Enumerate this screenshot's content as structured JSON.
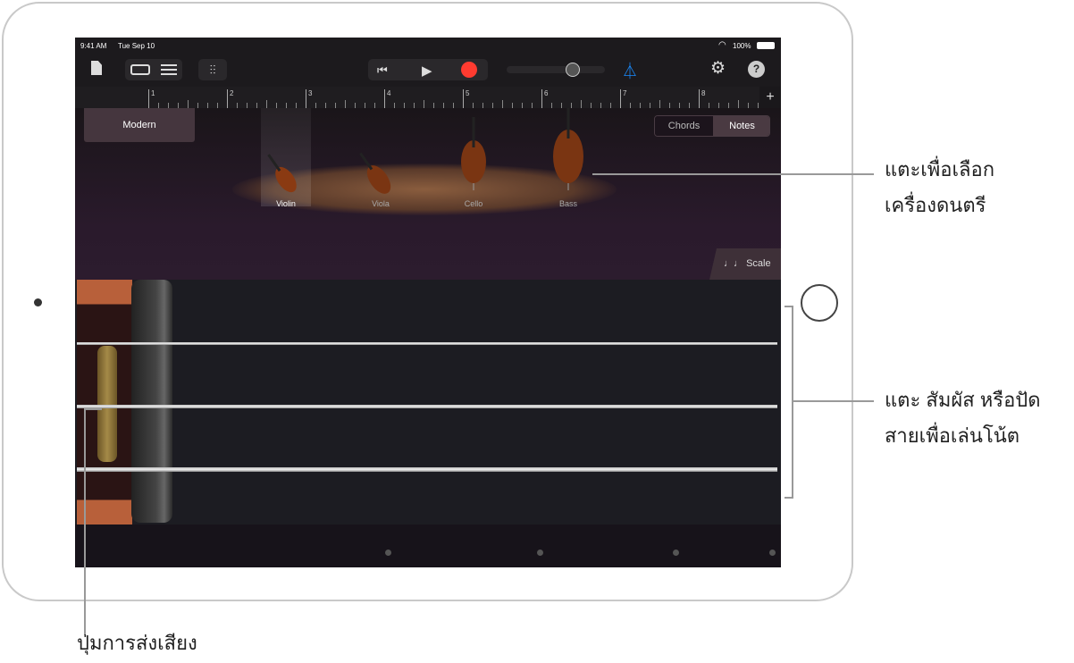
{
  "status": {
    "time": "9:41 AM",
    "date": "Tue Sep 10",
    "battery": "100%"
  },
  "toolbar": {
    "icons": [
      "document-icon",
      "tracks-view-icon",
      "list-view-icon",
      "mixer-icon",
      "rewind-icon",
      "play-icon",
      "record-icon",
      "metronome-icon",
      "settings-icon",
      "help-icon"
    ],
    "record_color": "#ff3b30",
    "metronome_color": "#1a8cff",
    "volume": 0.65
  },
  "ruler": {
    "bars": [
      "1",
      "2",
      "3",
      "4",
      "5",
      "6",
      "7",
      "8"
    ],
    "add": "+"
  },
  "preset": "Modern",
  "mode": {
    "chords": "Chords",
    "notes": "Notes",
    "selected": "Notes"
  },
  "instruments": [
    {
      "label": "Violin",
      "selected": true
    },
    {
      "label": "Viola"
    },
    {
      "label": "Cello"
    },
    {
      "label": "Bass"
    }
  ],
  "scale": "Scale",
  "callouts": {
    "instrument": [
      "แตะเพื่อเลือก",
      "เครื่องดนตรี"
    ],
    "strings": [
      "แตะ สัมผัส หรือปัด",
      "สายเพื่อเล่นโน้ต"
    ],
    "articulation": "ปุ่มการส่งเสียง"
  }
}
